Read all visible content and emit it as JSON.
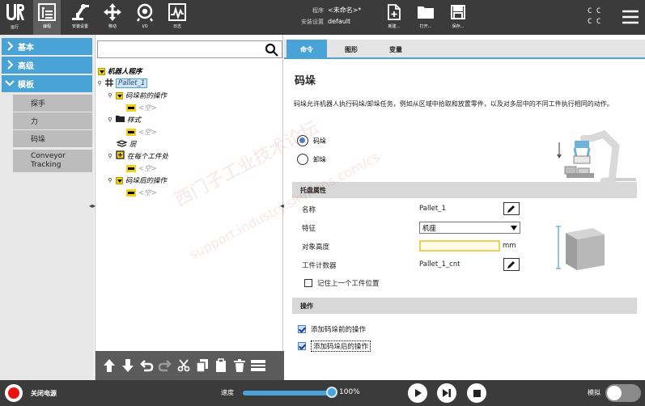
{
  "header": {
    "logo_label": "运行",
    "buttons": [
      {
        "label": "编程",
        "icon": "program-tree-icon",
        "active": true
      },
      {
        "label": "安装设置",
        "icon": "robot-arm-icon"
      },
      {
        "label": "移动",
        "icon": "move-arrows-icon"
      },
      {
        "label": "I/O",
        "icon": "io-icon"
      },
      {
        "label": "日志",
        "icon": "log-chart-icon"
      }
    ],
    "program_key": "程序",
    "program_value": "<未命名>*",
    "install_key": "安装设置",
    "install_value": "default",
    "file_buttons": [
      {
        "label": "新建...",
        "icon": "new-file-icon"
      },
      {
        "label": "打开...",
        "icon": "open-folder-icon"
      },
      {
        "label": "保存...",
        "icon": "save-disk-icon"
      }
    ],
    "cc": [
      "C C",
      "C C"
    ]
  },
  "nav": {
    "sections": [
      {
        "label": "基本",
        "expanded": false
      },
      {
        "label": "高级",
        "expanded": false
      },
      {
        "label": "模板",
        "expanded": true
      }
    ],
    "template_items": [
      "探手",
      "力",
      "码垛",
      "Conveyor Tracking"
    ]
  },
  "tree": {
    "search_placeholder": "",
    "rows": [
      {
        "text": "机器人程序",
        "style": "bold-italic"
      },
      {
        "text": "Pallet_1",
        "style": "selected"
      },
      {
        "text": "码垛前的操作",
        "style": "italic"
      },
      {
        "text": "<空>",
        "style": "empty"
      },
      {
        "text": "样式",
        "style": "italic"
      },
      {
        "text": "<空>",
        "style": "empty"
      },
      {
        "text": "层",
        "style": "italic"
      },
      {
        "text": "在每个工件处",
        "style": "italic"
      },
      {
        "text": "<空>",
        "style": "empty"
      },
      {
        "text": "码垛后的操作",
        "style": "italic"
      },
      {
        "text": "<空>",
        "style": "empty"
      }
    ],
    "toolbar": [
      "move-up-icon",
      "move-down-icon",
      "undo-icon",
      "redo-icon",
      "cut-icon",
      "copy-icon",
      "paste-icon",
      "delete-icon",
      "suppress-icon"
    ]
  },
  "right": {
    "tabs": [
      "命令",
      "图形",
      "变量"
    ],
    "title": "码垛",
    "description": "码垛允许机器人执行码垛/卸垛任务，例如从区域中拾取和放置零件，以及对多层中的不同工件执行相同的动作。",
    "radio_options": [
      {
        "label": "码垛",
        "selected": true
      },
      {
        "label": "卸垛",
        "selected": false
      }
    ],
    "props_header": "托盘属性",
    "name_label": "名称",
    "name_value": "Pallet_1",
    "feature_label": "特征",
    "feature_value": "机座",
    "height_label": "对象高度",
    "height_unit": "mm",
    "counter_label": "工件计数器",
    "counter_value": "Pallet_1_cnt",
    "remember_label": "记住上一个工件位置",
    "ops_header": "操作",
    "add_before_label": "添加码垛前的操作",
    "add_after_label": "添加码垛后的操作"
  },
  "footer": {
    "power_label": "关闭电源",
    "speed_label": "速度",
    "speed_value": "100%",
    "speed_fraction": 1.0,
    "sim_label": "模拟"
  },
  "watermark": [
    "西门子工业技术论坛",
    "support.industry.siemens.com/cs"
  ],
  "colors": {
    "accent": "#4aa3d6",
    "header": "#3b3b3b",
    "yellow": "#f2cf1a"
  }
}
